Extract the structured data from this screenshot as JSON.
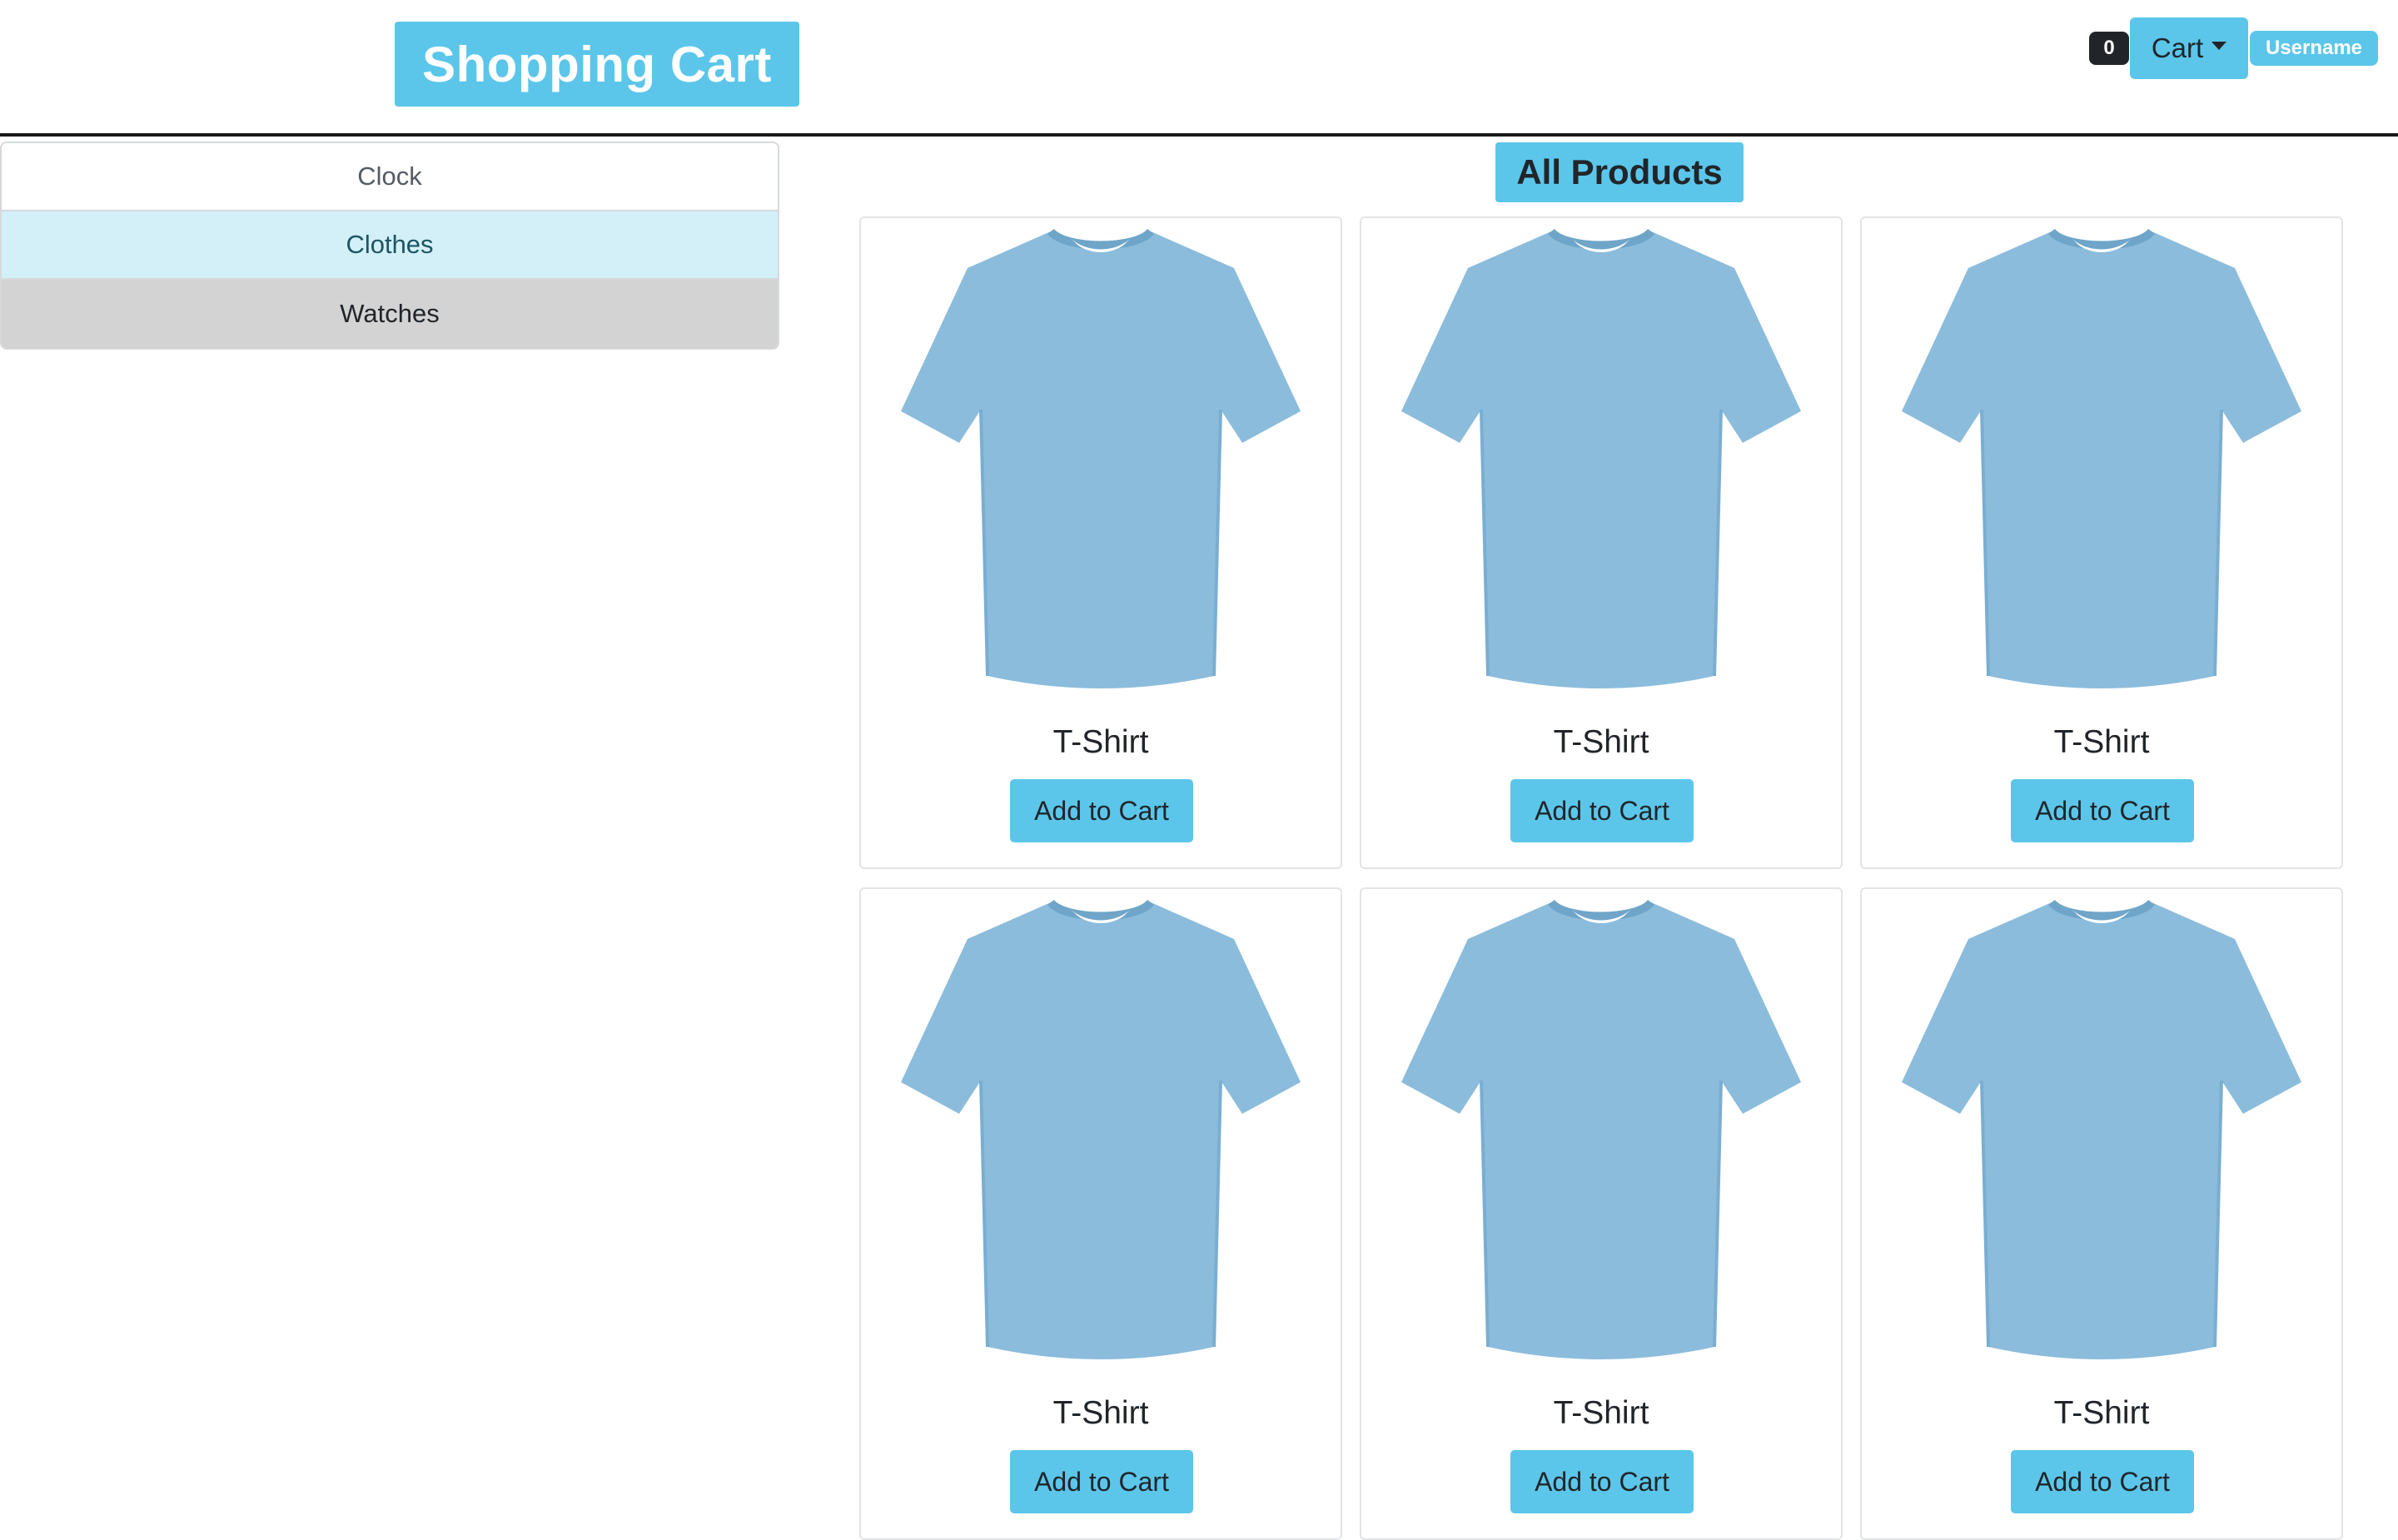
{
  "header": {
    "brand": "Shopping Cart",
    "cart_count": "0",
    "cart_label": "Cart",
    "username": "Username"
  },
  "categories": [
    {
      "label": "Clock",
      "state": "plain"
    },
    {
      "label": "Clothes",
      "state": "info"
    },
    {
      "label": "Watches",
      "state": "active"
    }
  ],
  "main": {
    "title": "All Products",
    "products": [
      {
        "name": "T-Shirt",
        "button": "Add to Cart",
        "image_icon": "t-shirt-image"
      },
      {
        "name": "T-Shirt",
        "button": "Add to Cart",
        "image_icon": "t-shirt-image"
      },
      {
        "name": "T-Shirt",
        "button": "Add to Cart",
        "image_icon": "t-shirt-image"
      },
      {
        "name": "T-Shirt",
        "button": "Add to Cart",
        "image_icon": "t-shirt-image"
      },
      {
        "name": "T-Shirt",
        "button": "Add to Cart",
        "image_icon": "t-shirt-image"
      },
      {
        "name": "T-Shirt",
        "button": "Add to Cart",
        "image_icon": "t-shirt-image"
      }
    ]
  },
  "colors": {
    "accent": "#5bc6ea",
    "dark_badge": "#212529",
    "shirt": "#8bbcdc"
  }
}
